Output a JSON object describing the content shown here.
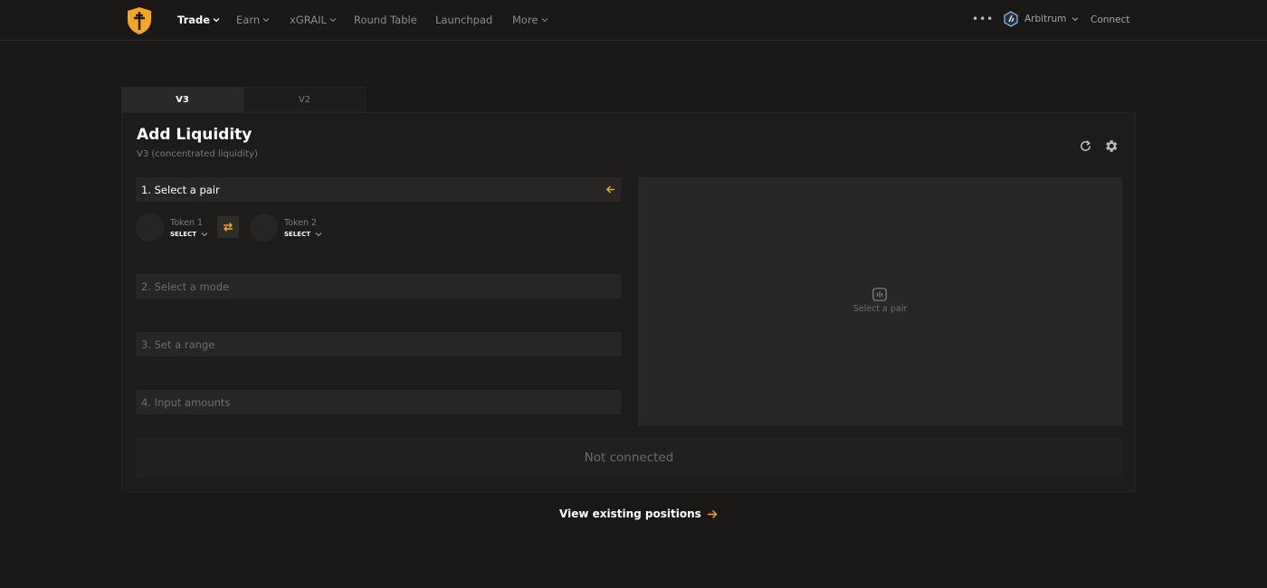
{
  "nav": {
    "items": [
      {
        "label": "Trade",
        "has_dropdown": true,
        "active": true
      },
      {
        "label": "Earn",
        "has_dropdown": true
      },
      {
        "label": "xGRAIL",
        "has_dropdown": true
      },
      {
        "label": "Round Table",
        "has_dropdown": false
      },
      {
        "label": "Launchpad",
        "has_dropdown": false
      },
      {
        "label": "More",
        "has_dropdown": true
      }
    ],
    "more_icon": "ellipsis-icon",
    "network": "Arbitrum",
    "connect_label": "Connect"
  },
  "tabs": [
    {
      "label": "V3",
      "active": true
    },
    {
      "label": "V2",
      "active": false
    }
  ],
  "card": {
    "title": "Add Liquidity",
    "subtitle": "V3 (concentrated liquidity)",
    "steps": [
      {
        "label": "1. Select a pair",
        "active": true
      },
      {
        "label": "2. Select a mode",
        "active": false
      },
      {
        "label": "3. Set a range",
        "active": false
      },
      {
        "label": "4. Input amounts",
        "active": false
      }
    ],
    "token1": {
      "label": "Token 1",
      "select_label": "SELECT"
    },
    "token2": {
      "label": "Token 2",
      "select_label": "SELECT"
    },
    "chart_placeholder": "Select a pair",
    "status_button": "Not connected"
  },
  "view_positions_label": "View existing positions",
  "colors": {
    "accent": "#f5a623",
    "background": "#191816",
    "card": "#1d1c1a",
    "panel": "#282725"
  }
}
